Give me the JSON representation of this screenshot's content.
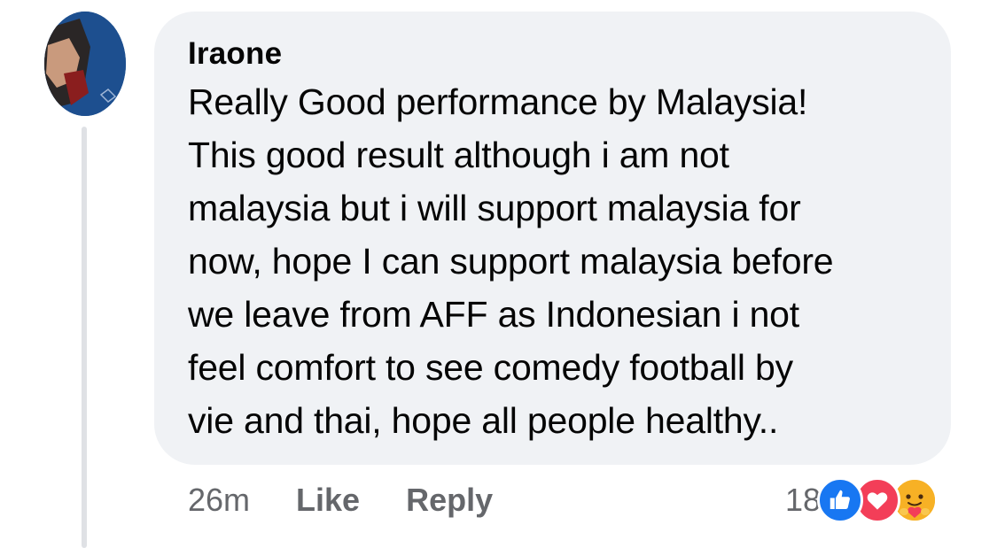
{
  "comment": {
    "author": "Iraone",
    "text": "Really Good performance by Malaysia!\nThis good result although i am not\nmalaysia but i will support malaysia for\nnow, hope I can support malaysia before\nwe leave from AFF as Indonesian i not\nfeel comfort to see comedy football by\nvie and thai, hope all people healthy..",
    "time": "26m",
    "like_label": "Like",
    "reply_label": "Reply",
    "reaction_count": "18",
    "reactions": [
      "like-icon",
      "love-icon",
      "care-icon"
    ]
  },
  "colors": {
    "bubble": "#f0f2f5",
    "meta_text": "#65676b",
    "like_blue": "#1877f2",
    "love_red": "#f33e58",
    "care_yellow": "#f7b125"
  }
}
